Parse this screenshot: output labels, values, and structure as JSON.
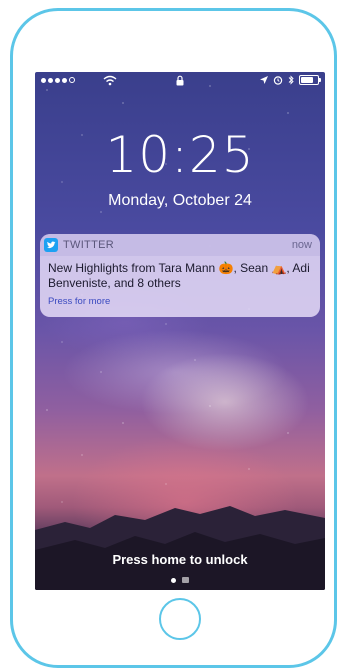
{
  "colors": {
    "device_outline": "#5cc6e8",
    "twitter_blue": "#1da1f2",
    "notification_bg": "#e1d7f5",
    "action_link": "#3a4ac0"
  },
  "status_bar": {
    "signal_icon": "signal-dots-icon",
    "wifi_icon": "wifi-icon",
    "lock_icon": "lock-icon",
    "location_icon": "location-arrow-icon",
    "alarm_icon": "alarm-clock-icon",
    "bluetooth_icon": "bluetooth-icon",
    "battery_icon": "battery-icon",
    "battery_level": 0.75
  },
  "lock_screen": {
    "time": "10:25",
    "date": "Monday, October 24",
    "unlock_hint": "Press home to unlock"
  },
  "notification": {
    "app_icon": "twitter-bird-icon",
    "app_name": "TWITTER",
    "time": "now",
    "message": "New Highlights from Tara Mann 🎃, Sean ⛺, Adi Benveniste, and 8 others",
    "action": "Press for more"
  },
  "pagination": {
    "icons": [
      "page-dot-icon",
      "camera-icon"
    ]
  }
}
